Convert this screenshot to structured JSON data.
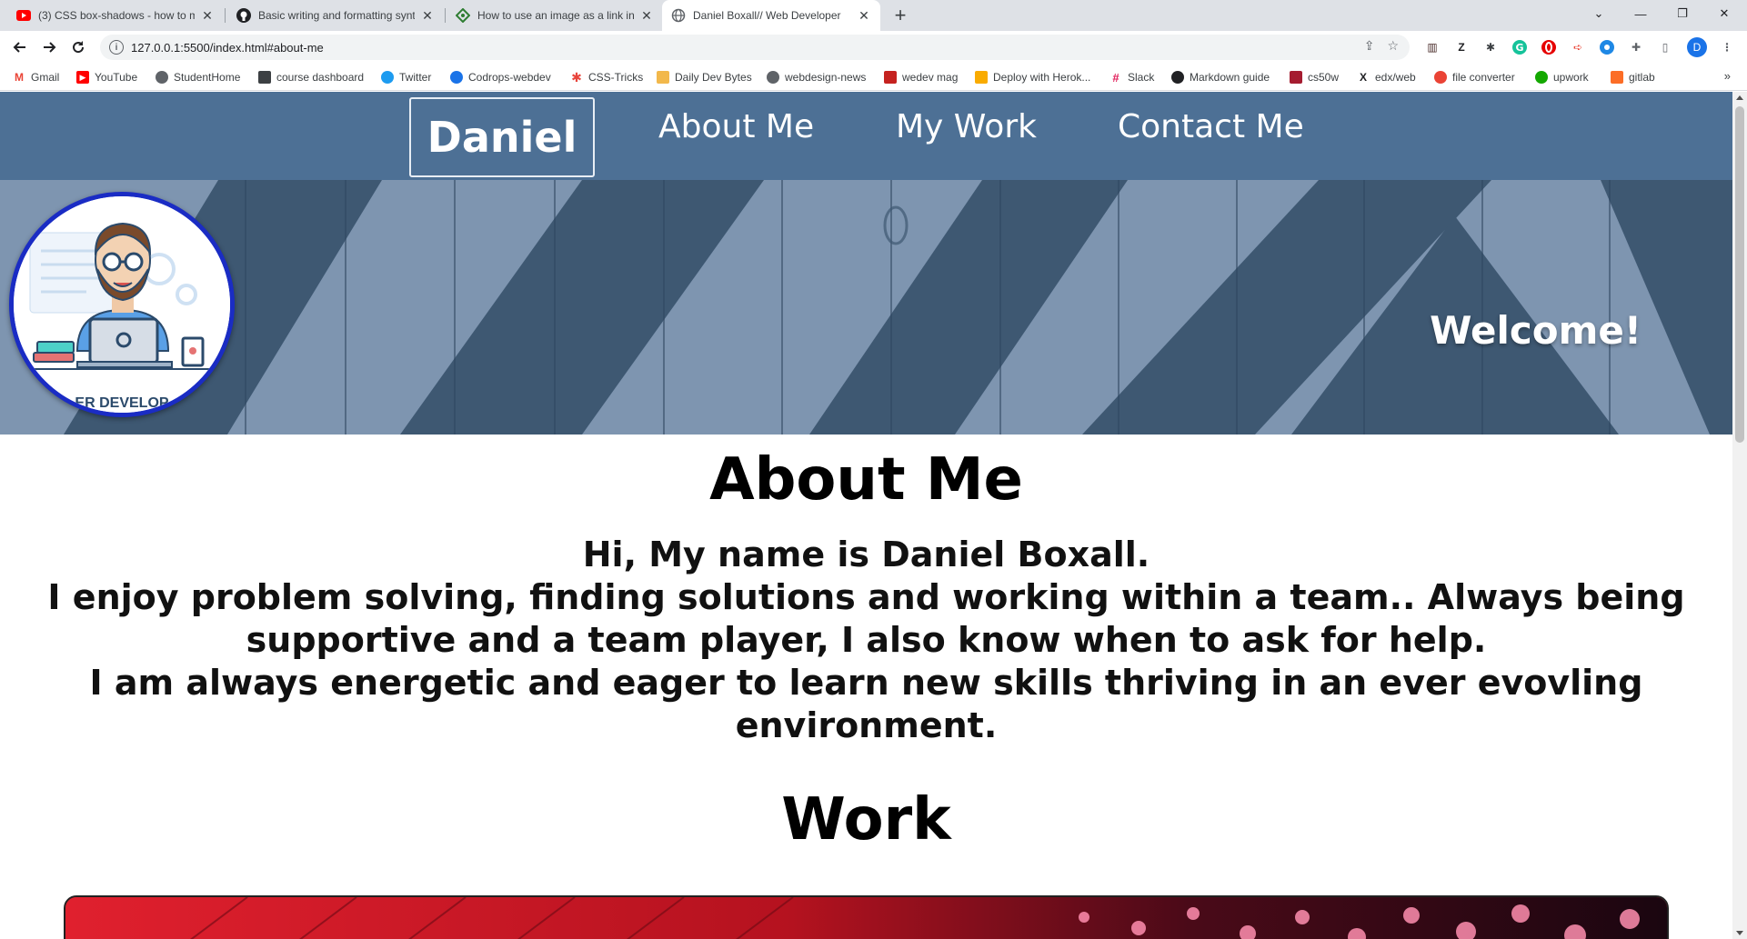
{
  "browser": {
    "tabs": [
      {
        "title": "(3) CSS box-shadows - how to m",
        "favicon": "youtube-icon",
        "active": false
      },
      {
        "title": "Basic writing and formatting synt",
        "favicon": "github-icon",
        "active": false
      },
      {
        "title": "How to use an image as a link in",
        "favicon": "diamond-icon",
        "active": false
      },
      {
        "title": "Daniel Boxall// Web Developer",
        "favicon": "globe-icon",
        "active": true
      }
    ],
    "url": "127.0.0.1:5500/index.html#about-me",
    "profile_initial": "D",
    "bookmarks": [
      {
        "label": "Gmail",
        "icon": "gmail-icon",
        "color": "#ea4335"
      },
      {
        "label": "YouTube",
        "icon": "youtube-icon",
        "color": "#ff0000"
      },
      {
        "label": "StudentHome",
        "icon": "globe-icon",
        "color": "#5f6368"
      },
      {
        "label": "course dashboard",
        "icon": "course-icon",
        "color": "#3c4043"
      },
      {
        "label": "Twitter",
        "icon": "twitter-icon",
        "color": "#1d9bf0"
      },
      {
        "label": "Codrops-webdev",
        "icon": "codrops-icon",
        "color": "#1a73e8"
      },
      {
        "label": "CSS-Tricks",
        "icon": "csstricks-icon",
        "color": "#e8453c"
      },
      {
        "label": "Daily Dev Bytes",
        "icon": "bytes-icon",
        "color": "#f2b84b"
      },
      {
        "label": "webdesign-news",
        "icon": "globe-icon",
        "color": "#5f6368"
      },
      {
        "label": "wedev mag",
        "icon": "webdevmag-icon",
        "color": "#c5221f"
      },
      {
        "label": "Deploy with Herok...",
        "icon": "freecodecamp-icon",
        "color": "#f9ab00"
      },
      {
        "label": "Slack",
        "icon": "slack-icon",
        "color": "#4a154b"
      },
      {
        "label": "Markdown guide",
        "icon": "markdown-icon",
        "color": "#202124"
      },
      {
        "label": "cs50w",
        "icon": "harvard-icon",
        "color": "#a51c30"
      },
      {
        "label": "edx/web",
        "icon": "edx-icon",
        "color": "#202124"
      },
      {
        "label": "file converter",
        "icon": "converter-icon",
        "color": "#ea4335"
      },
      {
        "label": "upwork",
        "icon": "upwork-icon",
        "color": "#14a800"
      },
      {
        "label": "gitlab",
        "icon": "gitlab-icon",
        "color": "#fc6d26"
      }
    ]
  },
  "site": {
    "brand": "Daniel",
    "nav": [
      "About Me",
      "My Work",
      "Contact Me"
    ],
    "hero_welcome": "Welcome!",
    "profile_caption": "ER DEVELOP",
    "about_title": "About Me",
    "about_lines": [
      "Hi, My name is Daniel Boxall.",
      "I enjoy problem solving, finding solutions and working within a team.. Always being supportive and a team player, I also know when to ask for help.",
      "I am always energetic and eager to learn new skills thriving in an ever evovling environment."
    ],
    "work_title": "Work"
  },
  "colors": {
    "nav_bg": "#4d7095",
    "hero_stripe_dark": "#3e5872",
    "hero_stripe_light": "#7e95b0",
    "profile_border": "#1a2cc4",
    "work_card_red": "#d61d2c"
  }
}
